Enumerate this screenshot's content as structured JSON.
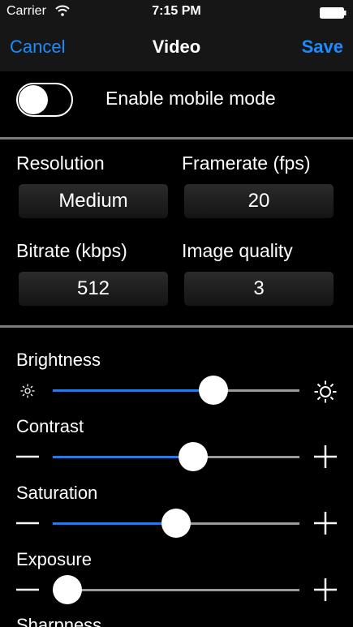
{
  "status_bar": {
    "carrier": "Carrier",
    "time": "7:15 PM"
  },
  "nav": {
    "cancel": "Cancel",
    "title": "Video",
    "save": "Save"
  },
  "mobile_mode": {
    "label": "Enable mobile mode",
    "enabled": false
  },
  "settings": {
    "resolution": {
      "label": "Resolution",
      "value": "Medium"
    },
    "framerate": {
      "label": "Framerate (fps)",
      "value": "20"
    },
    "bitrate": {
      "label": "Bitrate (kbps)",
      "value": "512"
    },
    "image_quality": {
      "label": "Image quality",
      "value": "3"
    }
  },
  "sliders": {
    "brightness": {
      "label": "Brightness",
      "value": 0.65,
      "min_icon": "sun-small-icon",
      "max_icon": "sun-large-icon"
    },
    "contrast": {
      "label": "Contrast",
      "value": 0.57,
      "min_icon": "minus-icon",
      "max_icon": "plus-icon"
    },
    "saturation": {
      "label": "Saturation",
      "value": 0.5,
      "min_icon": "minus-icon",
      "max_icon": "plus-icon"
    },
    "exposure": {
      "label": "Exposure",
      "value": 0.06,
      "min_icon": "minus-icon",
      "max_icon": "plus-icon"
    },
    "sharpness": {
      "label": "Sharpness"
    }
  },
  "colors": {
    "accent": "#1a8cff",
    "track": "#9a9a9a",
    "track_fill": "#1a7bff"
  }
}
